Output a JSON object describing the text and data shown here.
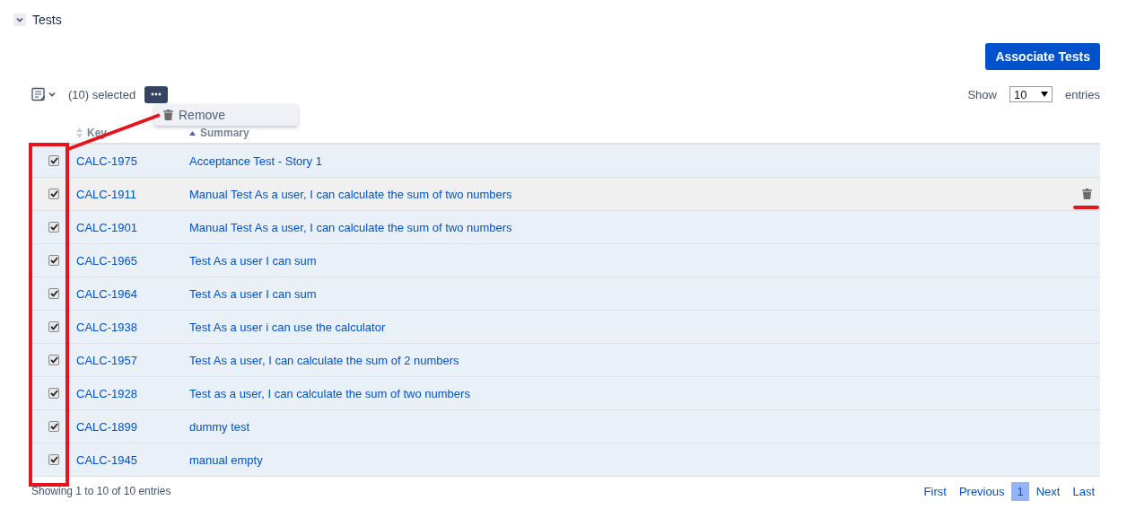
{
  "section": {
    "title": "Tests",
    "expanded": true
  },
  "associate_button": "Associate Tests",
  "toolbar": {
    "selected_count": "(10) selected",
    "menu_items": [
      "Remove"
    ]
  },
  "page_length": {
    "label_before": "Show",
    "value": "10",
    "label_after": "entries"
  },
  "table": {
    "columns": [
      {
        "label": "Key",
        "sorted_asc": false
      },
      {
        "label": "Summary",
        "sorted_asc": true
      }
    ],
    "rows": [
      {
        "key": "CALC-1975",
        "summary": "Acceptance Test - Story 1",
        "checked": true,
        "hovered": false
      },
      {
        "key": "CALC-1911",
        "summary": "Manual Test As a user, I can calculate the sum of two numbers",
        "checked": true,
        "hovered": true
      },
      {
        "key": "CALC-1901",
        "summary": "Manual Test As a user, I can calculate the sum of two numbers",
        "checked": true,
        "hovered": false
      },
      {
        "key": "CALC-1965",
        "summary": "Test As a user I can sum",
        "checked": true,
        "hovered": false
      },
      {
        "key": "CALC-1964",
        "summary": "Test As a user I can sum",
        "checked": true,
        "hovered": false
      },
      {
        "key": "CALC-1938",
        "summary": "Test As a user i can use the calculator",
        "checked": true,
        "hovered": false
      },
      {
        "key": "CALC-1957",
        "summary": "Test As a user, I can calculate the sum of 2 numbers",
        "checked": true,
        "hovered": false
      },
      {
        "key": "CALC-1928",
        "summary": "Test as a user, I can calculate the sum of two numbers",
        "checked": true,
        "hovered": false
      },
      {
        "key": "CALC-1899",
        "summary": "dummy test",
        "checked": true,
        "hovered": false
      },
      {
        "key": "CALC-1945",
        "summary": "manual empty",
        "checked": true,
        "hovered": false
      }
    ]
  },
  "footer": {
    "info": "Showing 1 to 10 of 10 entries",
    "pagination": [
      {
        "label": "First",
        "selected": false
      },
      {
        "label": "Previous",
        "selected": false
      },
      {
        "label": "1",
        "selected": true
      },
      {
        "label": "Next",
        "selected": false
      },
      {
        "label": "Last",
        "selected": false
      }
    ]
  }
}
